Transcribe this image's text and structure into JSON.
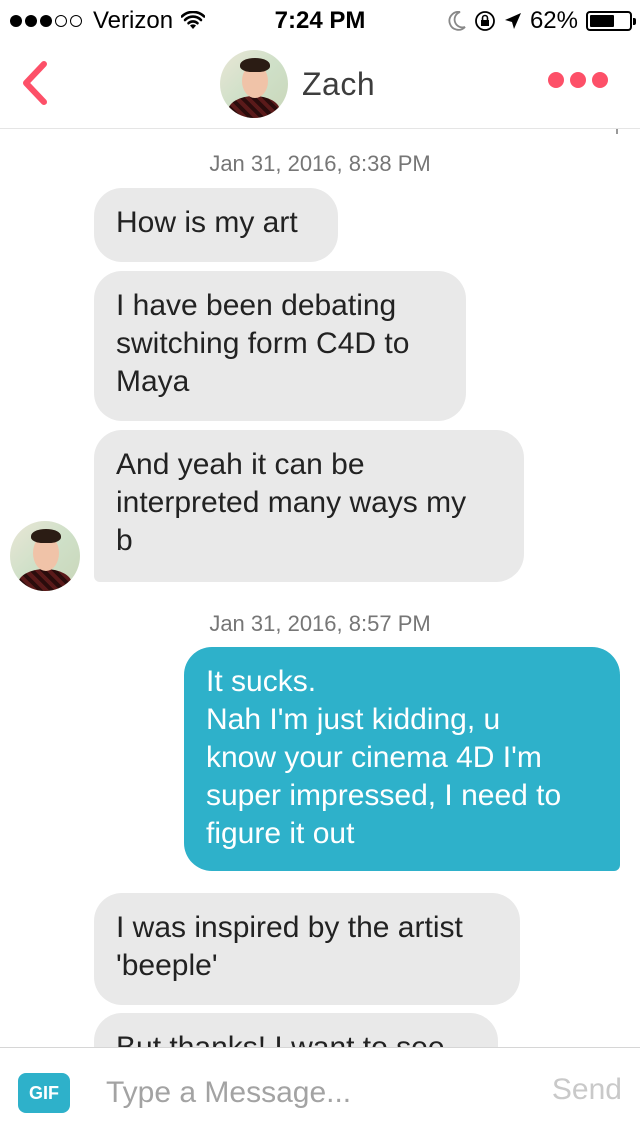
{
  "status_bar": {
    "signal_full_dots": 3,
    "signal_empty_dots": 2,
    "carrier": "Verizon",
    "time": "7:24 PM",
    "battery_percent": "62%",
    "battery_level": 0.62,
    "icons": [
      "wifi-icon",
      "moon-icon",
      "rotation-lock-icon",
      "location-arrow-icon",
      "battery-icon"
    ]
  },
  "header": {
    "contact_name": "Zach",
    "back_icon": "chevron-left-icon",
    "more_icon": "more-dots-icon",
    "accent_color": "#fd5068"
  },
  "conversation": {
    "timestamps": [
      "Jan 31, 2016, 8:38 PM",
      "Jan 31, 2016, 8:57 PM"
    ],
    "messages": [
      {
        "from": "them",
        "lines": [
          "How is my art"
        ]
      },
      {
        "from": "them",
        "lines": [
          "I have been debating",
          "switching form C4D to",
          "Maya"
        ]
      },
      {
        "from": "them",
        "lines": [
          "And yeah it can be",
          "interpreted many ways my",
          "b"
        ]
      },
      {
        "from": "me",
        "lines": [
          "It sucks.",
          "Nah I'm just kidding, u",
          "know your cinema 4D I'm",
          "super impressed, I need to",
          "figure it out"
        ]
      },
      {
        "from": "them",
        "lines": [
          "I was inspired by the artist",
          "'beeple'"
        ]
      },
      {
        "from": "them",
        "lines": [
          "But thanks! I want to see"
        ]
      }
    ],
    "colors": {
      "incoming_bubble": "#e9e9e9",
      "outgoing_bubble": "#2eb1ca"
    }
  },
  "input_bar": {
    "gif_label": "GIF",
    "placeholder": "Type a Message...",
    "value": "",
    "send_label": "Send"
  }
}
